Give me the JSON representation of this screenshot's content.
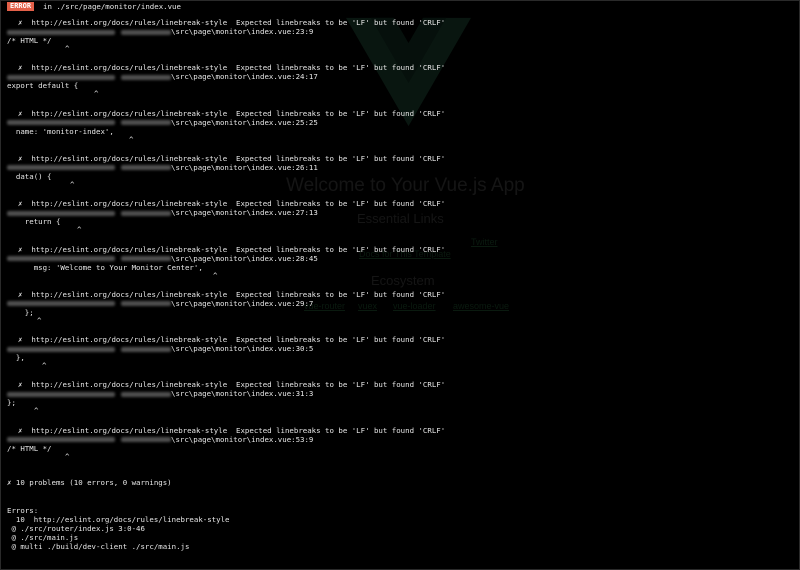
{
  "header": {
    "badge": "ERROR",
    "text": "in ./src/page/monitor/index.vue"
  },
  "problems": [
    {
      "message": "http://eslint.org/docs/rules/linebreak-style  Expected linebreaks to be 'LF' but found 'CRLF'",
      "path": "\\src\\page\\monitor\\index.vue:23:9",
      "code": "/* HTML */",
      "caret": "^"
    },
    {
      "message": "http://eslint.org/docs/rules/linebreak-style  Expected linebreaks to be 'LF' but found 'CRLF'",
      "path": "\\src\\page\\monitor\\index.vue:24:17",
      "code": "export default {",
      "caret": "^"
    },
    {
      "message": "http://eslint.org/docs/rules/linebreak-style  Expected linebreaks to be 'LF' but found 'CRLF'",
      "path": "\\src\\page\\monitor\\index.vue:25:25",
      "code": "  name: 'monitor-index',",
      "caret": "^"
    },
    {
      "message": "http://eslint.org/docs/rules/linebreak-style  Expected linebreaks to be 'LF' but found 'CRLF'",
      "path": "\\src\\page\\monitor\\index.vue:26:11",
      "code": "  data() {",
      "caret": "^"
    },
    {
      "message": "http://eslint.org/docs/rules/linebreak-style  Expected linebreaks to be 'LF' but found 'CRLF'",
      "path": "\\src\\page\\monitor\\index.vue:27:13",
      "code": "    return {",
      "caret": "^"
    },
    {
      "message": "http://eslint.org/docs/rules/linebreak-style  Expected linebreaks to be 'LF' but found 'CRLF'",
      "path": "\\src\\page\\monitor\\index.vue:28:45",
      "code": "      msg: 'Welcome to Your Monitor Center',",
      "caret": "^"
    },
    {
      "message": "http://eslint.org/docs/rules/linebreak-style  Expected linebreaks to be 'LF' but found 'CRLF'",
      "path": "\\src\\page\\monitor\\index.vue:29:7",
      "code": "    };",
      "caret": "^"
    },
    {
      "message": "http://eslint.org/docs/rules/linebreak-style  Expected linebreaks to be 'LF' but found 'CRLF'",
      "path": "\\src\\page\\monitor\\index.vue:30:5",
      "code": "  },",
      "caret": "^"
    },
    {
      "message": "http://eslint.org/docs/rules/linebreak-style  Expected linebreaks to be 'LF' but found 'CRLF'",
      "path": "\\src\\page\\monitor\\index.vue:31:3",
      "code": "};",
      "caret": "^"
    },
    {
      "message": "http://eslint.org/docs/rules/linebreak-style  Expected linebreaks to be 'LF' but found 'CRLF'",
      "path": "\\src\\page\\monitor\\index.vue:53:9",
      "code": "/* HTML */",
      "caret": "^"
    }
  ],
  "cross_glyph": "✗",
  "summary": "✗ 10 problems (10 errors, 0 warnings)",
  "errors_section": {
    "title": "Errors:",
    "rule_line": "  10  http://eslint.org/docs/rules/linebreak-style",
    "stack": [
      " @ ./src/router/index.js 3:0-46",
      " @ ./src/main.js",
      " @ multi ./build/dev-client ./src/main.js"
    ]
  },
  "background_app": {
    "title": "Welcome to Your Vue.js App",
    "essential_links_heading": "Essential Links",
    "essential_links": [
      "Twitter",
      "Docs for This Template"
    ],
    "ecosystem_heading": "Ecosystem",
    "ecosystem_links": [
      "vue-router",
      "vuex",
      "vue-loader",
      "awesome-vue"
    ]
  }
}
